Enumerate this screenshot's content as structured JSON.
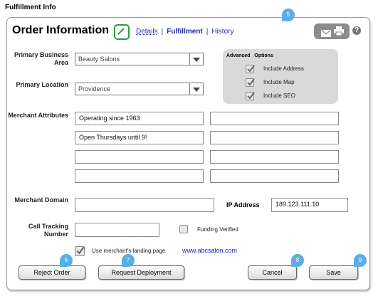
{
  "page_label": "Fulfillment Info",
  "header": {
    "title": "Order Information",
    "tabs": [
      {
        "label": "Details"
      },
      {
        "label": "Fulfillment"
      },
      {
        "label": "History"
      }
    ],
    "help": "?"
  },
  "callouts": [
    "5",
    "6",
    "7",
    "8",
    "9"
  ],
  "form": {
    "primary_business_area": {
      "label": "Primary Business Area",
      "value": "Beauty Salons"
    },
    "primary_location": {
      "label": "Primary Location",
      "value": "Providence"
    },
    "merchant_attributes": {
      "label": "Merchant Attributes",
      "values": [
        "Operating since 1963",
        "",
        "Open Thursdays until 9!",
        "",
        "",
        "",
        "",
        ""
      ]
    },
    "merchant_domain": {
      "label": "Merchant Domain",
      "value": ""
    },
    "ip_address": {
      "label": "IP Address",
      "value": "189.123.111.10"
    },
    "call_tracking": {
      "label": "Call Tracking Number",
      "value": ""
    },
    "funding_verified": {
      "label": "Funding Verified",
      "checked": false
    },
    "use_landing_page": {
      "label": "Use merchant's landing page",
      "checked": true,
      "url": "www.abcsalon.com"
    }
  },
  "advanced": {
    "title": "Advanced Options",
    "options": [
      {
        "label": "Include Address",
        "checked": true
      },
      {
        "label": "Include Map",
        "checked": true
      },
      {
        "label": "Include SEO",
        "checked": true
      }
    ]
  },
  "buttons": {
    "reject": "Reject Order",
    "request": "Request Deployment",
    "cancel": "Cancel",
    "save": "Save"
  },
  "colors": {
    "link": "#1a2aa0",
    "callout": "#5aaee6",
    "edit_icon": "#2a9c3a"
  }
}
